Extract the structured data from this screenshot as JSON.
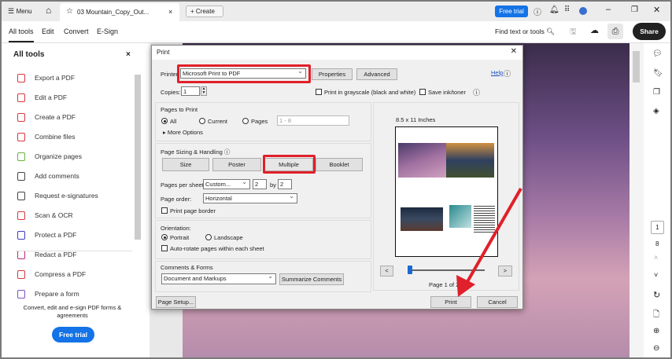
{
  "app": {
    "menu_label": "Menu",
    "tab_title": "03 Mountain_Copy_Out...",
    "create_label": "Create",
    "free_trial": "Free trial"
  },
  "toolbar": {
    "tabs": [
      "All tools",
      "Edit",
      "Convert",
      "E-Sign"
    ],
    "find": "Find text or tools",
    "share": "Share"
  },
  "sidebar": {
    "title": "All tools",
    "items": [
      "Export a PDF",
      "Edit a PDF",
      "Create a PDF",
      "Combine files",
      "Organize pages",
      "Add comments",
      "Request e-signatures",
      "Scan & OCR",
      "Protect a PDF",
      "Redact a PDF",
      "Compress a PDF",
      "Prepare a form"
    ],
    "promo": "Convert, edit and e-sign PDF forms & agreements",
    "free_trial": "Free trial",
    "icon_colors": [
      "#d7373f",
      "#d7373f",
      "#d7373f",
      "#d7373f",
      "#6cb33f",
      "#444444",
      "#444444",
      "#d7373f",
      "#3d3dbf",
      "#c0287a",
      "#d7373f",
      "#7e4fc4"
    ]
  },
  "rail": {
    "page_current": "1",
    "page_total": "8"
  },
  "dialog": {
    "title": "Print",
    "printer_label": "Printer:",
    "printer_value": "Microsoft Print to PDF",
    "properties": "Properties",
    "advanced": "Advanced",
    "help": "Help",
    "copies_label": "Copies:",
    "copies_value": "1",
    "grayscale": "Print in grayscale (black and white)",
    "save_ink": "Save ink/toner",
    "pages_title": "Pages to Print",
    "all": "All",
    "current": "Current",
    "pages": "Pages",
    "pages_value": "1 - 8",
    "more_options": "More Options",
    "sizing_title": "Page Sizing & Handling",
    "size": "Size",
    "poster": "Poster",
    "multiple": "Multiple",
    "booklet": "Booklet",
    "pps_label": "Pages per sheet:",
    "pps_value": "Custom...",
    "cols": "2",
    "by": "by",
    "rows": "2",
    "order_label": "Page order:",
    "order_value": "Horizontal",
    "border": "Print page border",
    "orientation_label": "Orientation:",
    "portrait": "Portrait",
    "landscape": "Landscape",
    "autorotate": "Auto-rotate pages within each sheet",
    "comments_title": "Comments & Forms",
    "comments_value": "Document and Markups",
    "summarize": "Summarize Comments",
    "page_setup": "Page Setup...",
    "print": "Print",
    "cancel": "Cancel",
    "preview_size": "8.5 x 11 Inches",
    "preview_page": "Page 1 of 2 (1)",
    "prev": "<",
    "next": ">"
  },
  "annotation_color": "#e0202a"
}
